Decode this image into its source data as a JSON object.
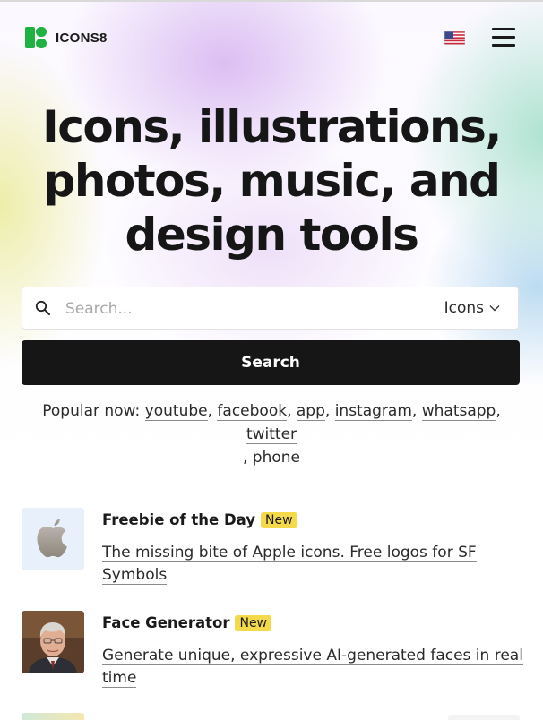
{
  "header": {
    "logo_text": "ICONS8",
    "language_flag": "us-flag-icon",
    "menu_icon": "hamburger-menu-icon"
  },
  "hero": {
    "headline_line1": "Icons, illustrations,",
    "headline_line2": "photos, music, and",
    "headline_line3": "design tools"
  },
  "search": {
    "placeholder": "Search...",
    "value": "",
    "type_selected": "Icons",
    "button_label": "Search"
  },
  "popular": {
    "label": "Popular now:",
    "items": [
      "youtube",
      "facebook",
      "app",
      "instagram",
      "whatsapp",
      "twitter",
      "phone"
    ]
  },
  "features": [
    {
      "title": "Freebie of the Day",
      "badge": "New",
      "description": "The missing bite of Apple icons. Free logos for SF Symbols"
    },
    {
      "title": "Face Generator",
      "badge": "New",
      "description": "Generate unique, expressive AI-generated faces in real time"
    }
  ],
  "colors": {
    "brand_green": "#1fb141",
    "badge_yellow": "#f4d94a",
    "button_dark": "#161616"
  }
}
